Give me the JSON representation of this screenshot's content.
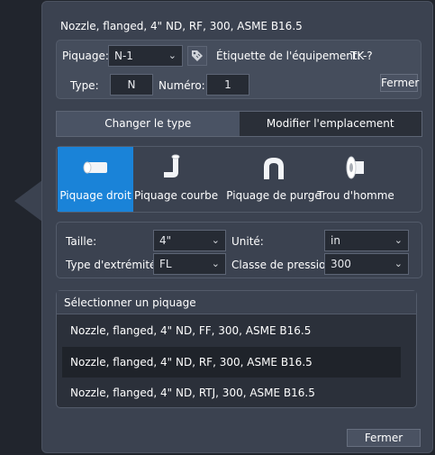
{
  "title": "Nozzle, flanged, 4\" ND, RF, 300, ASME B16.5",
  "header": {
    "piquage_label": "Piquage:",
    "piquage_value": "N-1",
    "equipment_tag_label": "Étiquette de l'équipement:",
    "equipment_tag_value": "TK-?",
    "type_label": "Type:",
    "type_value": "N",
    "number_label": "Numéro:",
    "number_value": "1",
    "close_label": "Fermer"
  },
  "tabs": [
    {
      "label": "Changer le type",
      "active": true
    },
    {
      "label": "Modifier l'emplacement",
      "active": false
    }
  ],
  "nozzle_types": [
    {
      "label": "Piquage droit",
      "icon": "straight-nozzle-icon",
      "selected": true
    },
    {
      "label": "Piquage courbe",
      "icon": "bent-nozzle-icon",
      "selected": false
    },
    {
      "label": "Piquage de purge",
      "icon": "vent-nozzle-icon",
      "selected": false
    },
    {
      "label": "Trou d'homme",
      "icon": "manhole-icon",
      "selected": false
    }
  ],
  "properties": {
    "size_label": "Taille:",
    "size_value": "4\"",
    "unit_label": "Unité:",
    "unit_value": "in",
    "end_type_label": "Type d'extrémité:",
    "end_type_value": "FL",
    "pressure_class_label": "Classe de pression:",
    "pressure_class_value": "300"
  },
  "nozzle_list": {
    "heading": "Sélectionner un piquage",
    "items": [
      {
        "label": "Nozzle, flanged, 4\" ND, FF, 300, ASME B16.5",
        "selected": false
      },
      {
        "label": "Nozzle, flanged, 4\" ND, RF, 300, ASME B16.5",
        "selected": true
      },
      {
        "label": "Nozzle, flanged, 4\" ND, RTJ, 300, ASME B16.5",
        "selected": false
      }
    ]
  },
  "footer": {
    "close_label": "Fermer"
  },
  "colors": {
    "accent": "#1a83d8",
    "panel": "#3b4250",
    "background": "#21252d"
  }
}
